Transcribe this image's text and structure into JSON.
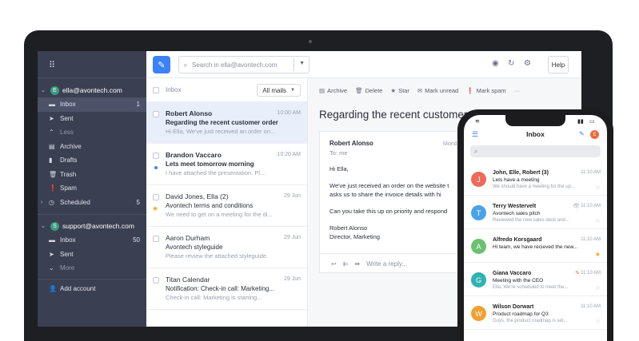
{
  "sidebar": {
    "accounts": [
      {
        "initial": "E",
        "email": "ella@avontech.com",
        "color": "#3a9b7f"
      },
      {
        "initial": "S",
        "email": "support@avontech.com",
        "color": "#3a9b7f"
      }
    ],
    "items1": [
      {
        "icon": "inbox-icon",
        "glyph": "▬",
        "label": "Inbox",
        "count": "1"
      },
      {
        "icon": "send-icon",
        "glyph": "➤",
        "label": "Sent",
        "count": ""
      },
      {
        "icon": "chevron-up-icon",
        "glyph": "⌃",
        "label": "Less",
        "count": ""
      },
      {
        "icon": "archive-icon",
        "glyph": "▤",
        "label": "Archive",
        "count": ""
      },
      {
        "icon": "drafts-icon",
        "glyph": "▮",
        "label": "Drafts",
        "count": ""
      },
      {
        "icon": "trash-icon",
        "glyph": "🗑",
        "label": "Trash",
        "count": ""
      },
      {
        "icon": "spam-icon",
        "glyph": "❗",
        "label": "Spam",
        "count": ""
      },
      {
        "icon": "scheduled-icon",
        "glyph": "◷",
        "label": "Scheduled",
        "count": "5"
      }
    ],
    "items2": [
      {
        "icon": "inbox-icon",
        "glyph": "▬",
        "label": "Inbox",
        "count": "50"
      },
      {
        "icon": "send-icon",
        "glyph": "➤",
        "label": "Sent",
        "count": ""
      },
      {
        "icon": "chevron-down-icon",
        "glyph": "⌄",
        "label": "More",
        "count": ""
      }
    ],
    "add_account": "Add account"
  },
  "toolbar": {
    "search_placeholder": "Search in ella@avontech.com",
    "help_label": "Help"
  },
  "list": {
    "header_label": "Inbox",
    "filter_label": "All mails",
    "messages": [
      {
        "from": "Robert Alonso",
        "date": "10:00 AM",
        "subject": "Regarding the recent customer order",
        "preview": "Hi Ella, We've just received an order on...",
        "selected": true,
        "unread": false,
        "starred": false
      },
      {
        "from": "Brandon Vaccaro",
        "date": "10:20 AM",
        "subject": "Lets meet tomorrow morning",
        "preview": "I have attached the presentation. Pl...",
        "selected": false,
        "unread": true,
        "starred": false
      },
      {
        "from": "David Jones, Ella (2)",
        "date": "29 Jun",
        "subject": "Avontech terms and conditions",
        "preview": "We need to get on a meeting for the di...",
        "selected": false,
        "unread": false,
        "starred": true
      },
      {
        "from": "Aaron Durham",
        "date": "29 Jun",
        "subject": "Avontech styleguide",
        "preview": "Please review the attached styleguide.",
        "selected": false,
        "unread": false,
        "starred": false
      },
      {
        "from": "Titan Calendar",
        "date": "29 Jun",
        "subject": "Notification: Check-in call: Marketing...",
        "preview": "Check-in call: Marketing is starting...",
        "selected": false,
        "unread": false,
        "starred": false
      }
    ]
  },
  "pane": {
    "actions": [
      {
        "icon": "archive-icon",
        "glyph": "▤",
        "label": "Archive"
      },
      {
        "icon": "trash-icon",
        "glyph": "🗑",
        "label": "Delete"
      },
      {
        "icon": "star-icon",
        "glyph": "★",
        "label": "Star"
      },
      {
        "icon": "mail-icon",
        "glyph": "✉",
        "label": "Mark unread"
      },
      {
        "icon": "spam-icon",
        "glyph": "❗",
        "label": "Mark spam"
      },
      {
        "icon": "more-icon",
        "glyph": "···",
        "label": ""
      }
    ],
    "title": "Regarding the recent customer order",
    "sender": "Robert Alonso",
    "to": "To: me",
    "date": "Monday",
    "greeting": "Hi Ella,",
    "body1a": "We've just received an order on the website t",
    "body1b": "asks us to share the invoice details with hi",
    "body2": "Can you take this up on priority and respond",
    "sign1": "Robert Alonso",
    "sign2": "Director, Marketing",
    "reply_placeholder": "Write a reply..."
  },
  "phone": {
    "time": "",
    "title": "Inbox",
    "avatar_initial": "E",
    "messages": [
      {
        "initial": "J",
        "color": "#ef6a5a",
        "from": "John, Elle, Robert (3)",
        "time": "11:10 AM",
        "subject": "Lets have a meeting",
        "preview": "We should have a meeting for the up...",
        "starred": false,
        "extra": ""
      },
      {
        "initial": "T",
        "color": "#4aa3e8",
        "from": "Terry Westervelt",
        "time": "11:10 AM",
        "subject": "Avontech sales pitch",
        "preview": "Reviewed the new sales deck and...",
        "starred": false,
        "extra": "👁"
      },
      {
        "initial": "A",
        "color": "#6cc070",
        "from": "Alfredo Korsgaard",
        "time": "11:10 AM",
        "subject": "Hi team, we have recieved the new...",
        "preview": "",
        "starred": true,
        "extra": ""
      },
      {
        "initial": "G",
        "color": "#2fb3b3",
        "from": "Giana Vaccaro",
        "time": "11:10 AM",
        "subject": "Meeting with the CEO",
        "preview": "Ella, We're scheduled to meet the...",
        "starred": false,
        "extra": "✎"
      },
      {
        "initial": "W",
        "color": "#f0a030",
        "from": "Wilson Dorwart",
        "time": "11:10 AM",
        "subject": "Product roadmap for Q3",
        "preview": "Guys, the product roadmap is set...",
        "starred": false,
        "extra": ""
      }
    ]
  }
}
